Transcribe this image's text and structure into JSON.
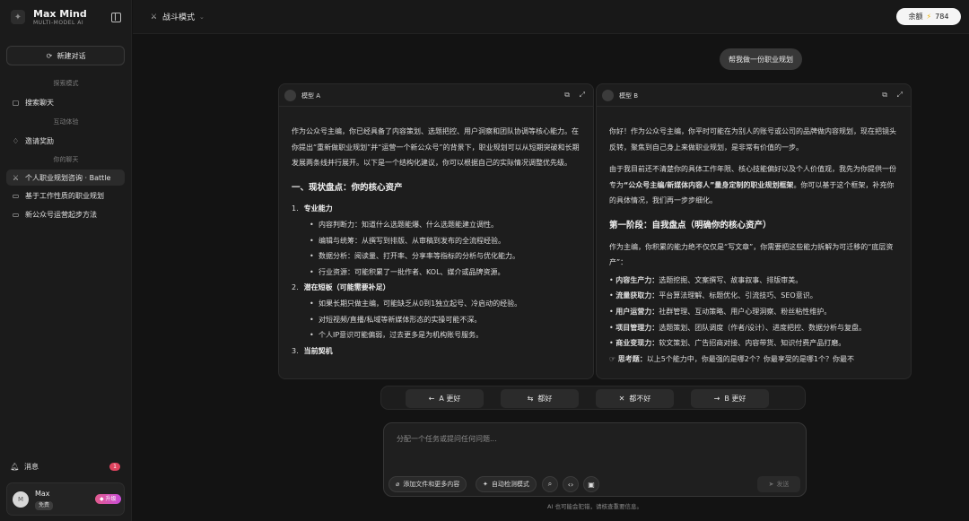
{
  "brand": {
    "name": "Max Mind",
    "subtitle": "MULTI-MODEL AI"
  },
  "sidebar": {
    "new_chat": "新建对话",
    "section_explore": "探索模式",
    "search_chat": "搜索聊天",
    "section_interact": "互动体验",
    "invite": "邀请奖励",
    "section_chats": "你的聊天",
    "chats": [
      {
        "label": "个人职业规划咨询 · Battle"
      },
      {
        "label": "基于工作性质的职业规划"
      },
      {
        "label": "新公众号运营起步方法"
      }
    ],
    "messages_label": "消息",
    "messages_count": "1",
    "user": {
      "name": "Max",
      "tag": "免费",
      "avatar": "M",
      "upgrade": "升级"
    }
  },
  "topbar": {
    "mode": "战斗模式",
    "balance_label": "余额",
    "balance_value": "784"
  },
  "user_message": "帮我做一份职业规划",
  "panel_a": {
    "title": "模型 A",
    "intro": "作为公众号主编，你已经具备了内容策划、选题把控、用户洞察和团队协调等核心能力。在你提出“重新做职业规划”并“运营一个新公众号”的背景下，职业规划可以从短期突破和长期发展两条线并行展开。以下是一个结构化建议，你可以根据自己的实际情况调整优先级。",
    "h1": "一、现状盘点：你的核心资产",
    "n1": "1.",
    "n1_title": "专业能力",
    "b1": "内容判断力：知道什么选题能爆、什么选题能建立调性。",
    "b2": "编辑与统筹：从撰写到排版、从审稿到发布的全流程经验。",
    "b3": "数据分析：阅读量、打开率、分享率等指标的分析与优化能力。",
    "b4": "行业资源：可能积累了一批作者、KOL、媒介或品牌资源。",
    "n2": "2.",
    "n2_title": "潜在短板（可能需要补足）",
    "b5": "如果长期只做主编，可能缺乏从0到1独立起号、冷启动的经验。",
    "b6": "对短视频/直播/私域等新媒体形态的实操可能不深。",
    "b7": "个人IP意识可能偏弱，过去更多是为机构账号服务。",
    "n3": "3.",
    "n3_title": "当前契机"
  },
  "panel_b": {
    "title": "模型 B",
    "p1": "你好！作为公众号主编，你平时可能在为别人的账号或公司的品牌做内容规划，现在把镜头反转，聚焦到自己身上来做职业规划，是非常有价值的一步。",
    "p2_a": "由于我目前还不清楚你的具体工作年限、核心技能偏好以及个人价值观，我先为你提供一份专为",
    "p2_b": "“公众号主编/新媒体内容人”量身定制的职业规划框架",
    "p2_c": "。你可以基于这个框架，补充你的具体情况，我们再一步步细化。",
    "h1": "第一阶段：自我盘点（明确你的核心资产）",
    "p3": "作为主编，你积累的能力绝不仅仅是“写文章”，你需要把这些能力拆解为可迁移的“底层资产”：",
    "i1_k": "内容生产力：",
    "i1_v": "选题挖掘、文案撰写、故事叙事、排版审美。",
    "i2_k": "流量获取力：",
    "i2_v": "平台算法理解、标题优化、引流技巧、SEO意识。",
    "i3_k": "用户运营力：",
    "i3_v": "社群管理、互动策略、用户心理洞察、粉丝粘性维护。",
    "i4_k": "项目管理力：",
    "i4_v": "选题策划、团队调度（作者/设计）、进度把控、数据分析与复盘。",
    "i5_k": "商业变现力：",
    "i5_v": "软文策划、广告招商对接、内容带货、知识付费产品打磨。",
    "think_k": "思考题：",
    "think_v": "以上5个能力中，你最强的是哪2个？你最享受的是哪1个？你最不"
  },
  "vote": {
    "a_better": "A 更好",
    "both_good": "都好",
    "both_bad": "都不好",
    "b_better": "B 更好"
  },
  "composer": {
    "placeholder": "分配一个任务或提问任何问题...",
    "attach": "添加文件和更多内容",
    "auto_detect": "自动检测模式",
    "send": "发送"
  },
  "footer": "AI 也可能会犯错，请核查重要信息。"
}
